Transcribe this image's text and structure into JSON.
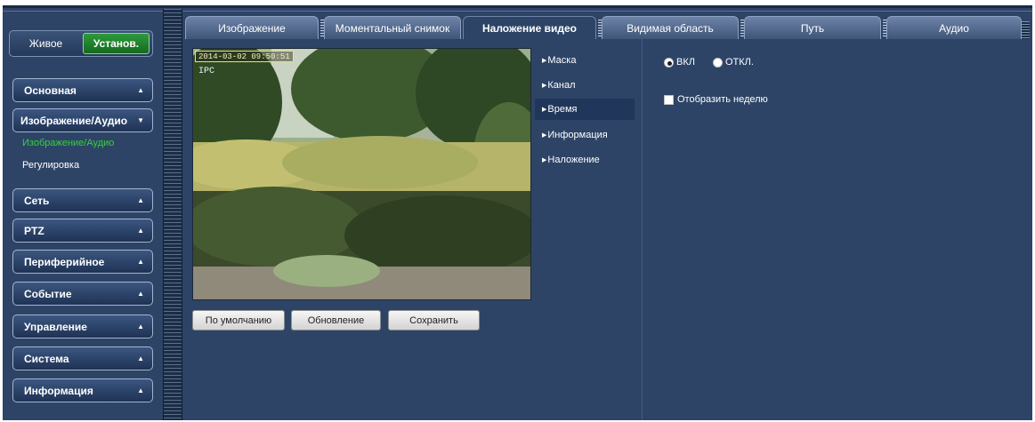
{
  "mode": {
    "live_label": "Живое",
    "setup_label": "Установ."
  },
  "sidebar": {
    "items": [
      {
        "label": "Основная"
      },
      {
        "label": "Изображение/Аудио"
      },
      {
        "label": "Сеть"
      },
      {
        "label": "PTZ"
      },
      {
        "label": "Периферийное"
      },
      {
        "label": "Событие"
      },
      {
        "label": "Управление"
      },
      {
        "label": "Система"
      },
      {
        "label": "Информация"
      }
    ],
    "sub_items": [
      {
        "label": "Изображение/Аудио",
        "active": true
      },
      {
        "label": "Регулировка",
        "active": false
      }
    ]
  },
  "tabs": [
    {
      "label": "Изображение"
    },
    {
      "label": "Моментальный снимок"
    },
    {
      "label": "Наложение видео",
      "active": true
    },
    {
      "label": "Видимая область"
    },
    {
      "label": "Путь"
    },
    {
      "label": "Аудио"
    }
  ],
  "video": {
    "timestamp": "2014-03-02 09:50:51",
    "channel_label": "IPC"
  },
  "buttons": {
    "default_label": "По умолчанию",
    "refresh_label": "Обновление",
    "save_label": "Сохранить"
  },
  "overlay_menu": [
    {
      "label": "Маска"
    },
    {
      "label": "Канал"
    },
    {
      "label": "Время",
      "selected": true
    },
    {
      "label": "Информация"
    },
    {
      "label": "Наложение"
    }
  ],
  "time_settings": {
    "on_label": "ВКЛ",
    "off_label": "ОТКЛ.",
    "selected": "on",
    "show_week_label": "Отобразить неделю",
    "show_week_checked": false
  },
  "colors": {
    "background": "#2d4466",
    "accent_green": "#35d13a",
    "setup_button": "#1a7f2a"
  }
}
